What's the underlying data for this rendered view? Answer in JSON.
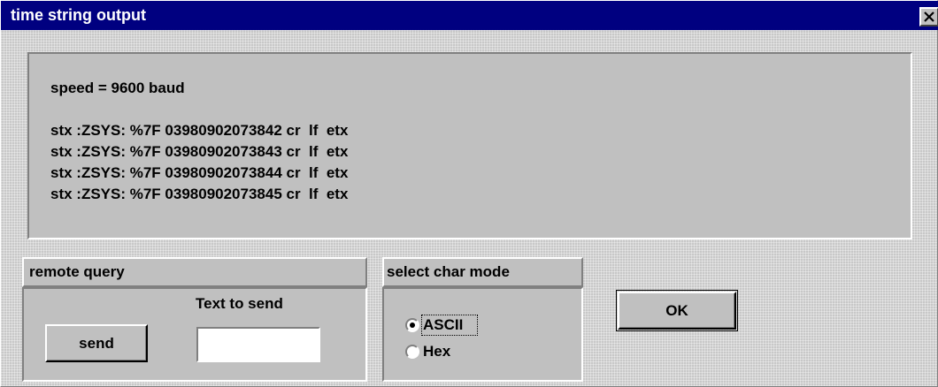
{
  "window": {
    "title": "time string output"
  },
  "output": {
    "speed": "speed = 9600 baud",
    "lines": [
      "stx :ZSYS: %7F 03980902073842 cr  lf  etx",
      "stx :ZSYS: %7F 03980902073843 cr  lf  etx",
      "stx :ZSYS: %7F 03980902073844 cr  lf  etx",
      "stx :ZSYS: %7F 03980902073845 cr  lf  etx"
    ]
  },
  "remote_query": {
    "title": "remote query",
    "text_to_send_label": "Text to send",
    "text_value": "",
    "send_label": "send"
  },
  "char_mode": {
    "title": "select char mode",
    "options": [
      "ASCII",
      "Hex"
    ],
    "selected": "ASCII"
  },
  "ok_label": "OK",
  "icons": {
    "close": "close-icon"
  },
  "colors": {
    "titlebar": "#000080",
    "face": "#c0c0c0"
  }
}
